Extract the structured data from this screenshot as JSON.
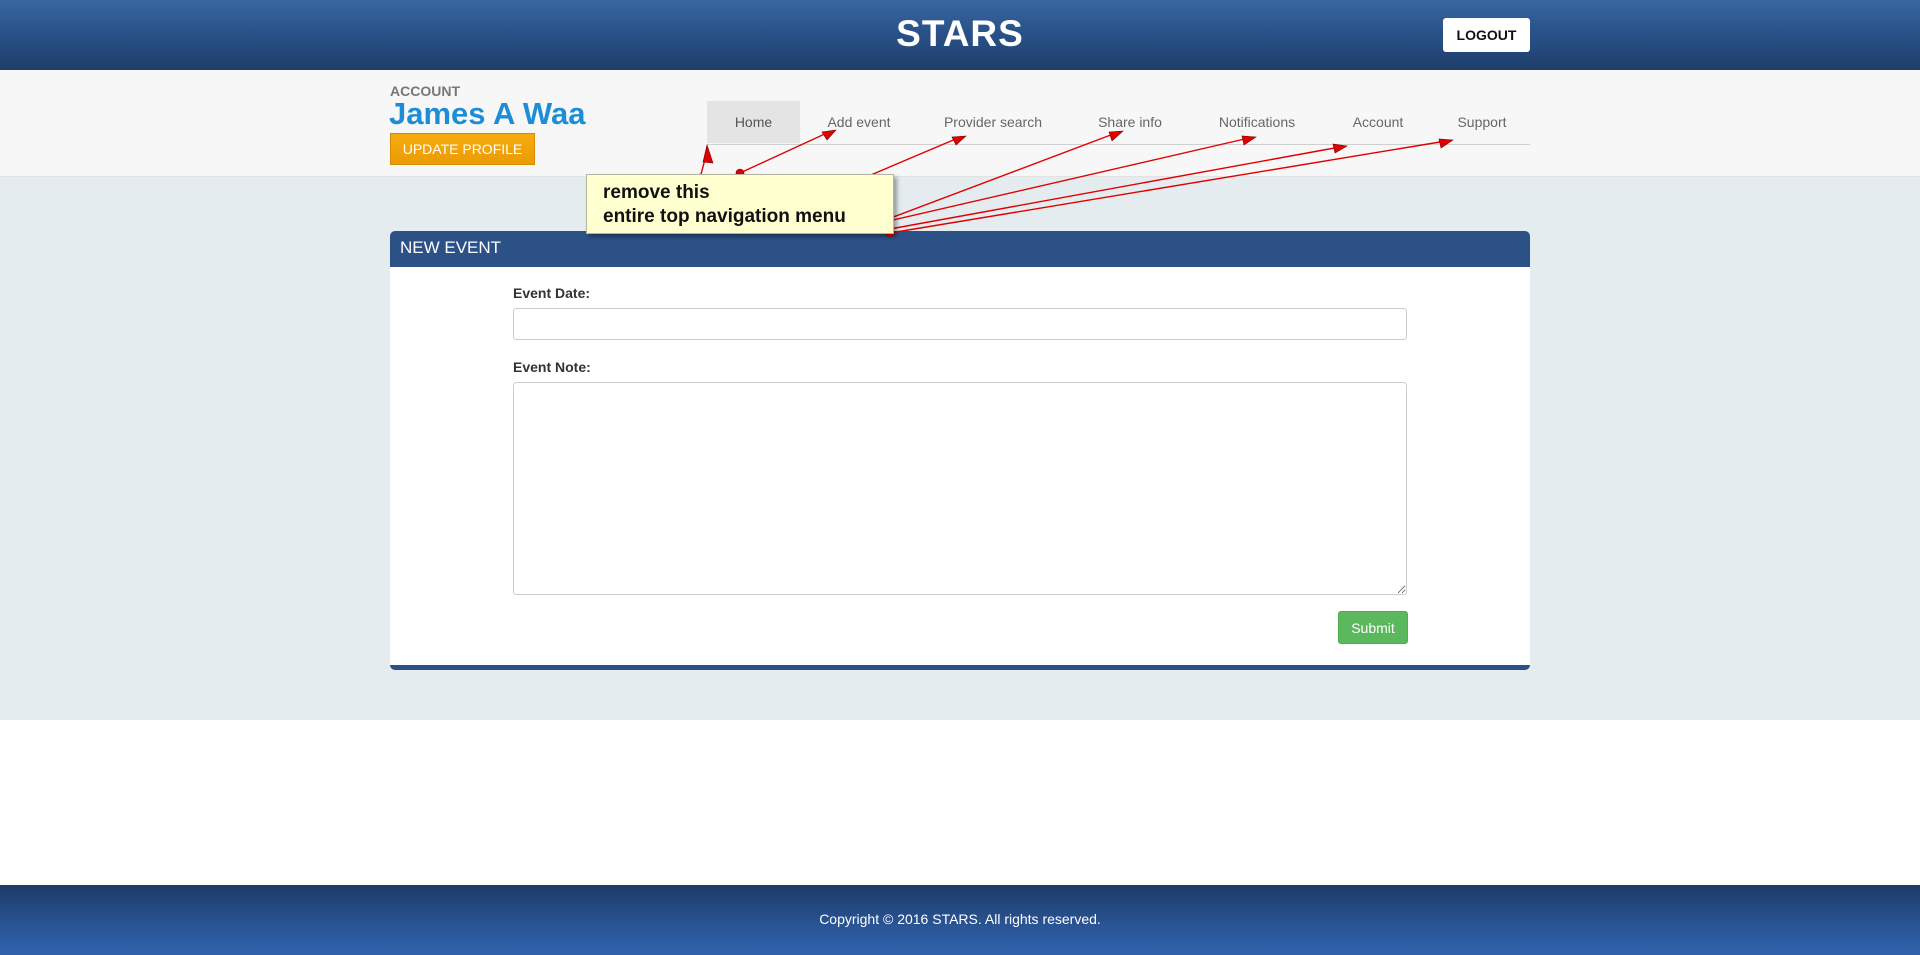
{
  "header": {
    "brand": "STARS",
    "logout_label": "LOGOUT"
  },
  "account": {
    "label": "ACCOUNT",
    "name": "James A Waa",
    "update_profile_label": "UPDATE PROFILE"
  },
  "nav": {
    "items": [
      {
        "label": "Home",
        "active": true
      },
      {
        "label": "Add event",
        "active": false
      },
      {
        "label": "Provider search",
        "active": false
      },
      {
        "label": "Share info",
        "active": false
      },
      {
        "label": "Notifications",
        "active": false
      },
      {
        "label": "Account",
        "active": false
      },
      {
        "label": "Support",
        "active": false
      }
    ]
  },
  "annotation": {
    "line1": "remove this",
    "line2": "entire top navigation menu"
  },
  "form": {
    "title": "NEW EVENT",
    "date_label": "Event Date:",
    "date_value": "",
    "note_label": "Event Note:",
    "note_value": "",
    "submit_label": "Submit"
  },
  "footer": {
    "copyright": "Copyright © 2016 STARS. All rights reserved."
  },
  "colors": {
    "primary": "#2c5187",
    "accent_blue": "#1d8ed6",
    "orange": "#f0a30a",
    "green": "#5cb85c",
    "annotation_red": "#e00000",
    "note_yellow": "#ffffd0"
  }
}
